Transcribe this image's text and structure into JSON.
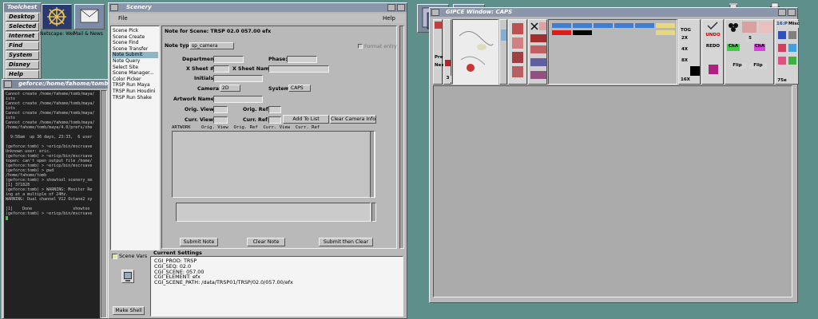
{
  "toolchest": {
    "title": "Toolchest",
    "items": [
      "Desktop",
      "Selected",
      "Internet",
      "Find",
      "System",
      "Disney",
      "Help"
    ]
  },
  "desktop_icons": [
    {
      "label": "Netscape: Wel",
      "icon": "netscape-icon"
    },
    {
      "label": "Mail & News",
      "icon": "mail-icon"
    }
  ],
  "terminal": {
    "title": "geforce:/home/fahome/tomb",
    "lines": [
      "Cannot create /home/fahome/tomb/maya/",
      "ists",
      "Cannot create /home/fahome/tomb/maya/",
      "ists",
      "Cannot create /home/fahome/tomb/maya/",
      "ists",
      "Cannot create /home/fahome/tomb/maya/",
      "/home/fahome/tomb/maya/4.0/prefs/she",
      "",
      "  9:58am  up 36 days, 23:33,  6 user",
      "",
      "(geforce:tomb) > ~ericp/bin/mscrsave",
      "Unknown user: eric.",
      "(geforce:tomb) > ~ericp/bin/mscrsave",
      "topen: can't open output file /home/",
      "(geforce:tomb) > ~ericp/bin/mscrsave",
      "(geforce:tomb) > pwd",
      "/home/fahome/tomb",
      "(geforce:tomb) > showtool scenery_nm",
      "[1] 371828",
      "(geforce:tomb) > WARNING: Monitor Re",
      "ing at a multiple of 24Hz.",
      "WARNING: Dual channel V12 Octane2 sy",
      "",
      "[1]    Done                 showtoo",
      "(geforce:tomb) > ~ericp/bin/mscrsave"
    ]
  },
  "scenery": {
    "title": "Scenery",
    "menu_file": "File",
    "menu_help": "Help",
    "list_items": [
      "Scene Pick",
      "Scene Create",
      "Scene Find",
      "Scene Transfer",
      "Note Submit",
      "Note Query",
      "Select Site",
      "Scene Manager...",
      "Color Picker",
      "TRSP Run Maya",
      "TRSP Run Houdini",
      "TRSP Run Shake"
    ],
    "selected_item": "Note Submit",
    "form": {
      "header": "Note for Scene: TRSP 02.0 057.00 efx",
      "note_type_label": "Note type:",
      "note_type_value": "sp_camera",
      "format_entry": "Format entry",
      "department_label": "Department:",
      "phase_label": "Phase:",
      "xsheet_label": "X Sheet #:",
      "xsheet_name_label": "X Sheet Name:",
      "initials_label": "Initials:",
      "camera_label": "Camera:",
      "camera_value": "2D",
      "system_label": "System:",
      "system_value": "CAPS",
      "artwork_label": "Artwork Name:",
      "orig_view_label": "Orig. View:",
      "orig_ref_label": "Orig. Ref:",
      "curr_view_label": "Curr. View:",
      "curr_ref_label": "Curr. Ref:",
      "add_to_list": "Add To List",
      "clear_camera_info": "Clear Camera Info",
      "columns_header": "ARTWORK    Orig. View  Orig. Ref  Curr. View  Curr. Ref",
      "submit_note": "Submit Note",
      "clear_note": "Clear Note",
      "submit_then_clear": "Submit then Clear"
    },
    "scene_vars": "Scene Vars",
    "make_shell": "Make Shell",
    "current_settings": {
      "title": "Current Settings",
      "rows": [
        {
          "key": "CGI_PROD:",
          "value": "TRSP"
        },
        {
          "key": "CGI_SEQ:",
          "value": "02.0"
        },
        {
          "key": "CGI_SCENE:",
          "value": "057.00"
        },
        {
          "key": "CGI_ELEMENT:",
          "value": "efx"
        },
        {
          "key": "CGI_SCENE_PATH:",
          "value": "/data/TRSP01/TRSP/02.0/057.00/efx"
        }
      ]
    }
  },
  "gipce": {
    "title": "GIPCE Window: CAPS",
    "labels": {
      "prev": "Prev",
      "next": "Next",
      "num": "3",
      "tog": "TOG",
      "two_x": "2X",
      "four_x": "4X",
      "eight_x": "8X",
      "sixteen_x": "16X",
      "undo": "UNDO",
      "redo": "REDO",
      "flip1": "Flip",
      "flip2": "Flip",
      "five": "5",
      "cha": "ChA",
      "chb": "ChA",
      "sixteen_p": "16:P",
      "misc": "Misc",
      "seventy_five": "75e"
    },
    "colors": {
      "blue": "#3e7fd6",
      "red": "#e01818",
      "black": "#000000",
      "yellow": "#e8d880",
      "magenta": "#e040e0",
      "green": "#30d030"
    }
  }
}
